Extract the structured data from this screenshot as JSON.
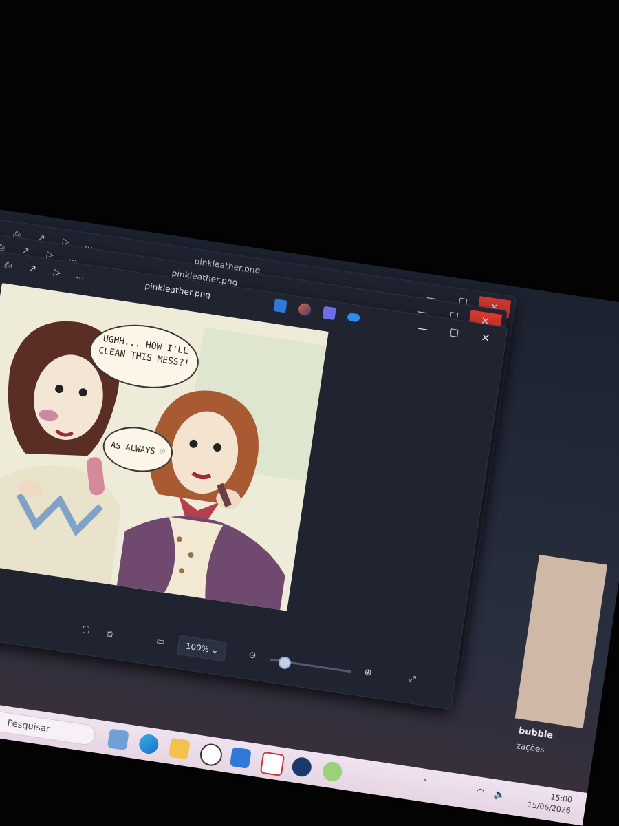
{
  "window": {
    "title": "pinkleather.png",
    "toolbar": {
      "print": "print-icon",
      "share": "share-icon",
      "slideshow": "slideshow-icon",
      "more": "..."
    },
    "controls": {
      "minimize": "—",
      "maximize": "☐",
      "close": "✕"
    }
  },
  "comic": {
    "bubble_1": "UGHH... HOW I'LL CLEAN THIS MESS?!",
    "bubble_2": "AS ALWAYS ♡"
  },
  "viewer": {
    "zoom_label": "100%",
    "zoom_fraction": 0.12
  },
  "side_panel": {
    "title": "bubble",
    "subtitle": "zações"
  },
  "taskbar": {
    "search_placeholder": "Pesquisar",
    "time": "15:00",
    "date": "15/06/2026"
  },
  "colors": {
    "accent": "#8ea8ff",
    "close_red": "#e23a2e",
    "taskbar": "#efe3ef"
  }
}
